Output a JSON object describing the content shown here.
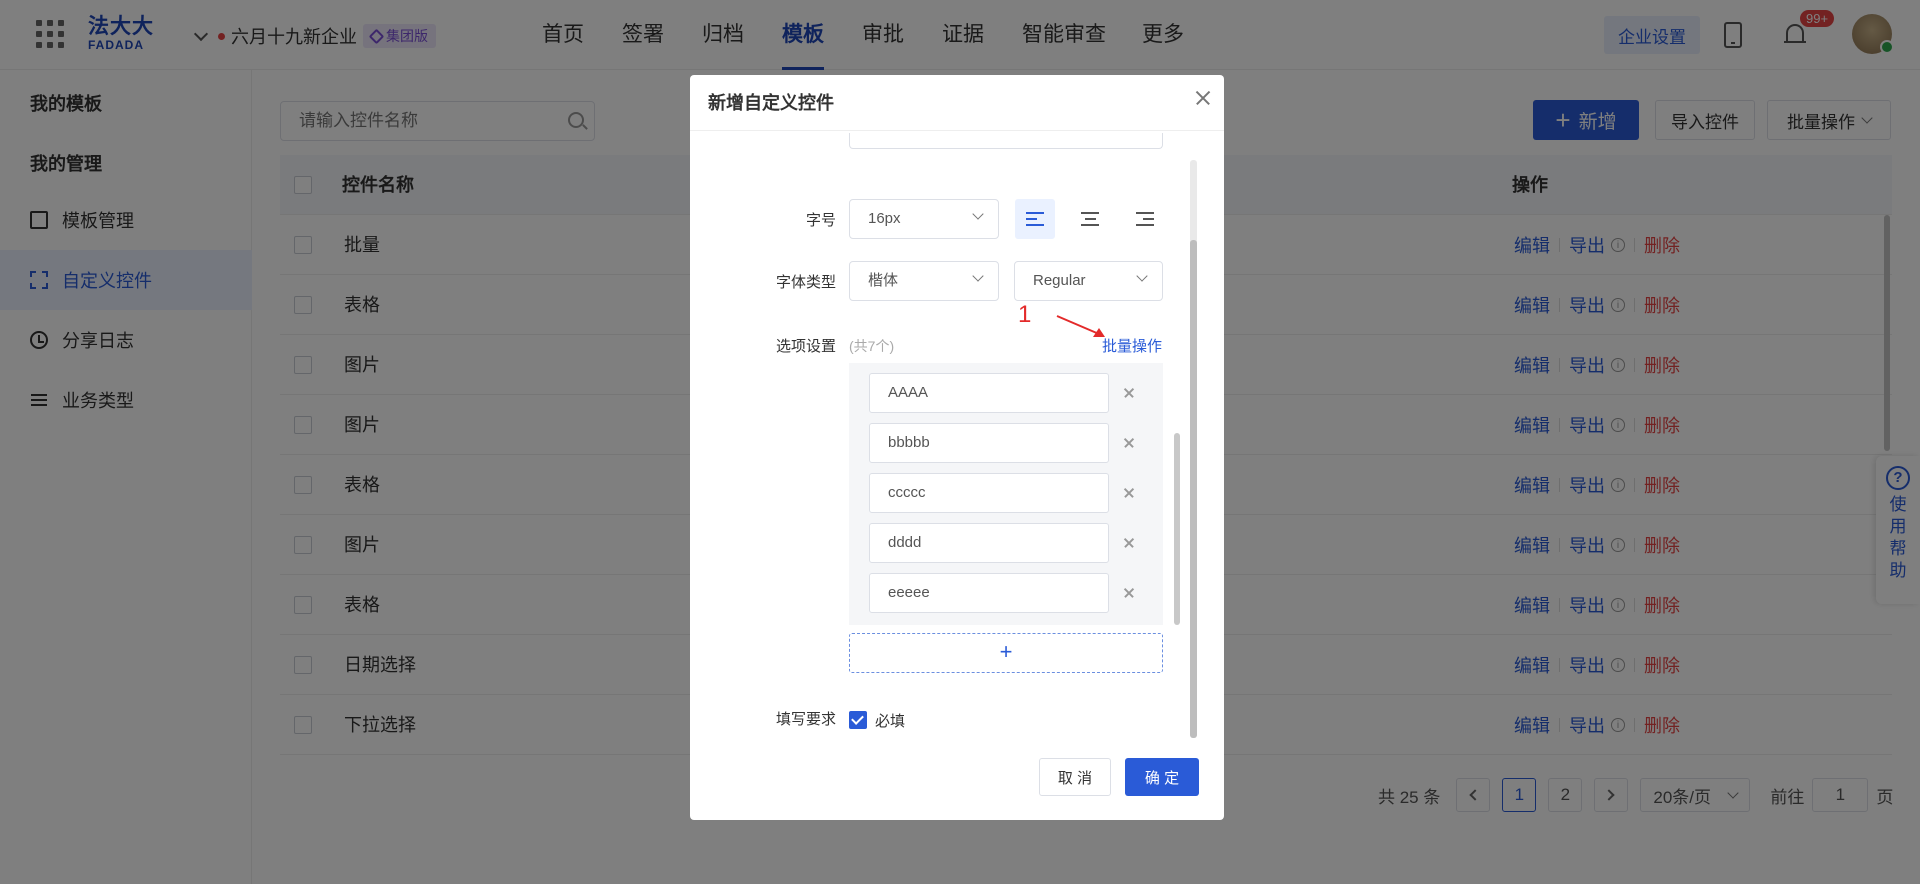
{
  "header": {
    "logo_cn": "法大大",
    "logo_en": "FADADA",
    "org_name": "六月十九新企业",
    "org_badge": "集团版",
    "nav": [
      "首页",
      "签署",
      "归档",
      "模板",
      "审批",
      "证据",
      "智能审查",
      "更多"
    ],
    "active_nav": "模板",
    "settings_label": "企业设置",
    "bell_count": "99+"
  },
  "sidebar": {
    "section_1": "我的模板",
    "section_2": "我的管理",
    "items": [
      {
        "label": "模板管理",
        "icon": "document-icon"
      },
      {
        "label": "自定义控件",
        "icon": "scan-icon",
        "active": true
      },
      {
        "label": "分享日志",
        "icon": "clock-icon"
      },
      {
        "label": "业务类型",
        "icon": "list-icon"
      }
    ]
  },
  "main": {
    "search_placeholder": "请输入控件名称",
    "add_label": "新增",
    "import_label": "导入控件",
    "batch_label": "批量操作",
    "columns": {
      "name": "控件名称",
      "ops": "操作"
    },
    "rows": [
      "批量",
      "表格",
      "图片",
      "图片",
      "表格",
      "图片",
      "表格",
      "日期选择",
      "下拉选择"
    ],
    "ops": {
      "edit": "编辑",
      "export": "导出",
      "delete": "删除"
    },
    "pagination": {
      "total": "共 25 条",
      "pages": [
        "1",
        "2"
      ],
      "current_page": "1",
      "page_size": "20条/页",
      "goto_prefix": "前往",
      "goto_value": "1",
      "goto_suffix": "页"
    }
  },
  "help": {
    "chars": [
      "使",
      "用",
      "帮",
      "助"
    ],
    "icon": "?"
  },
  "modal": {
    "title": "新增自定义控件",
    "font_size_label": "字号",
    "font_size_value": "16px",
    "font_type_label": "字体类型",
    "font_family_value": "楷体",
    "font_weight_value": "Regular",
    "options_label": "选项设置",
    "options_count": "(共7个)",
    "batch_link": "批量操作",
    "annotation_number": "1",
    "options": [
      "AAAA",
      "bbbbb",
      "ccccc",
      "dddd",
      "eeeee"
    ],
    "add_option": "+",
    "required_label": "填写要求",
    "required_checkbox": "必填",
    "cancel_label": "取 消",
    "ok_label": "确 定"
  },
  "colors": {
    "primary": "#2a5bd7",
    "danger": "#e64545",
    "annotation": "#e32a2a"
  }
}
